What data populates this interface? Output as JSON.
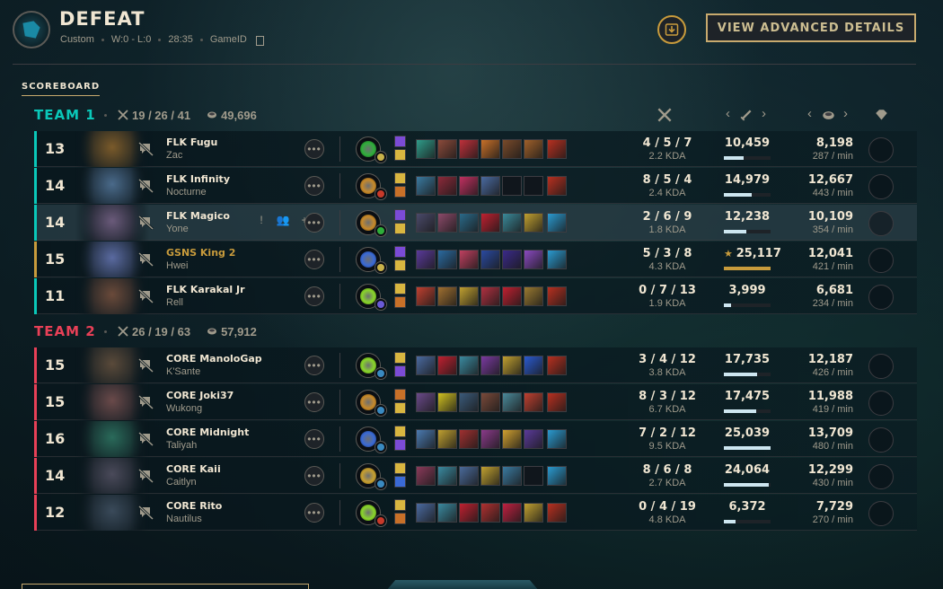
{
  "header": {
    "title": "DEFEAT",
    "mode": "Custom",
    "record": "W:0 - L:0",
    "duration": "28:35",
    "game_id_label": "GameID",
    "advanced_button": "VIEW ADVANCED DETAILS"
  },
  "scoreboard_label": "SCOREBOARD",
  "colors": {
    "gold_accent": "#c8aa6e",
    "team1": "#0ac8b9",
    "team2": "#e84057",
    "you": "#c89b3c",
    "text_light": "#f0e6d2",
    "text_muted": "#a09b8c"
  },
  "teams": [
    {
      "name": "TEAM 1",
      "kda": "19 / 26 / 41",
      "gold": "49,696",
      "players": [
        {
          "level": "13",
          "summoner": "FLK Fugu",
          "champion": "Zac",
          "kda": "4 / 5 / 7",
          "ratio": "2.2 KDA",
          "damage": "10,459",
          "damage_fraction": 0.42,
          "gold": "8,198",
          "gold_per_min": "287 / min",
          "portrait_color": "#7a5a2a",
          "keystone_color": "#2fae3a",
          "secondary_color": "#c8b24a",
          "spells": [
            "#7b4bd6",
            "#d8b640"
          ],
          "items": [
            "#2f9c8a",
            "#8c4a3a",
            "#c0303a",
            "#c87028",
            "#7a4a2a",
            "#a0602a",
            "#b83020"
          ],
          "you": false,
          "hovered": false
        },
        {
          "level": "14",
          "summoner": "FLK Infinity",
          "champion": "Nocturne",
          "kda": "8 / 5 / 4",
          "ratio": "2.4 KDA",
          "damage": "14,979",
          "damage_fraction": 0.6,
          "gold": "12,667",
          "gold_per_min": "443 / min",
          "portrait_color": "#4a6a8a",
          "keystone_color": "#c88a2a",
          "secondary_color": "#c83a2a",
          "spells": [
            "#d8b640",
            "#c87028"
          ],
          "items": [
            "#3a7aa0",
            "#8c2a3a",
            "#c03060",
            "#4a6aa0",
            "#10161c",
            "#10161c",
            "#b83020"
          ],
          "you": false,
          "hovered": false
        },
        {
          "level": "14",
          "summoner": "FLK Magico",
          "champion": "Yone",
          "kda": "2 / 6 / 9",
          "ratio": "1.8 KDA",
          "damage": "12,238",
          "damage_fraction": 0.49,
          "gold": "10,109",
          "gold_per_min": "354 / min",
          "portrait_color": "#6a5a7a",
          "keystone_color": "#c88a2a",
          "secondary_color": "#2fae3a",
          "spells": [
            "#7b4bd6",
            "#d8b640"
          ],
          "items": [
            "#4a4a6a",
            "#8c4a6a",
            "#2a6a8a",
            "#c02030",
            "#3a8a9a",
            "#c0a030",
            "#2a9ad0"
          ],
          "you": false,
          "hovered": true
        },
        {
          "level": "15",
          "summoner": "GSNS King 2",
          "champion": "Hwei",
          "kda": "5 / 3 / 8",
          "ratio": "4.3 KDA",
          "damage": "25,117",
          "damage_fraction": 1.0,
          "gold": "12,041",
          "gold_per_min": "421 / min",
          "portrait_color": "#5a6aa0",
          "keystone_color": "#3a6ad6",
          "secondary_color": "#c8b24a",
          "spells": [
            "#7b4bd6",
            "#d8b640"
          ],
          "items": [
            "#5a3a9a",
            "#2a6aa0",
            "#c04060",
            "#2a4aa0",
            "#3a2a8a",
            "#8a4ac0",
            "#2a9ad0"
          ],
          "you": true,
          "hovered": false
        },
        {
          "level": "11",
          "summoner": "FLK Karakal Jr",
          "champion": "Rell",
          "kda": "0 / 7 / 13",
          "ratio": "1.9 KDA",
          "damage": "3,999",
          "damage_fraction": 0.16,
          "gold": "6,681",
          "gold_per_min": "234 / min",
          "portrait_color": "#6a4a3a",
          "keystone_color": "#8ad62a",
          "secondary_color": "#6a5ad6",
          "spells": [
            "#d8b640",
            "#c87028"
          ],
          "items": [
            "#c04030",
            "#a07030",
            "#c0a030",
            "#b03040",
            "#c02030",
            "#9a7a30",
            "#b83020"
          ],
          "you": false,
          "hovered": false
        }
      ]
    },
    {
      "name": "TEAM 2",
      "kda": "26 / 19 / 63",
      "gold": "57,912",
      "players": [
        {
          "level": "15",
          "summoner": "CORE ManoloGap",
          "champion": "K'Sante",
          "kda": "3 / 4 / 12",
          "ratio": "3.8 KDA",
          "damage": "17,735",
          "damage_fraction": 0.71,
          "gold": "12,187",
          "gold_per_min": "426 / min",
          "portrait_color": "#5a4a3a",
          "keystone_color": "#8ad62a",
          "secondary_color": "#3a8ac0",
          "spells": [
            "#d8b640",
            "#7b4bd6"
          ],
          "items": [
            "#4a6aa0",
            "#c02030",
            "#3a8aa0",
            "#7a3aa0",
            "#c0a030",
            "#2a5ad0",
            "#b83020"
          ],
          "you": false,
          "hovered": false
        },
        {
          "level": "15",
          "summoner": "CORE Joki37",
          "champion": "Wukong",
          "kda": "8 / 3 / 12",
          "ratio": "6.7 KDA",
          "damage": "17,475",
          "damage_fraction": 0.7,
          "gold": "11,988",
          "gold_per_min": "419 / min",
          "portrait_color": "#6a4a4a",
          "keystone_color": "#c88a2a",
          "secondary_color": "#3a8ac0",
          "spells": [
            "#c87028",
            "#d8b640"
          ],
          "items": [
            "#6a4a8a",
            "#d0c020",
            "#3a5a7a",
            "#7a4a3a",
            "#4a8a9a",
            "#c04030",
            "#b83020"
          ],
          "you": false,
          "hovered": false
        },
        {
          "level": "16",
          "summoner": "CORE Midnight",
          "champion": "Taliyah",
          "kda": "7 / 2 / 12",
          "ratio": "9.5 KDA",
          "damage": "25,039",
          "damage_fraction": 1.0,
          "gold": "13,709",
          "gold_per_min": "480 / min",
          "portrait_color": "#2a6a5a",
          "keystone_color": "#3a6ad6",
          "secondary_color": "#3a8ac0",
          "spells": [
            "#d8b640",
            "#7b4bd6"
          ],
          "items": [
            "#4a7ab0",
            "#c0a030",
            "#a03030",
            "#8a3a8a",
            "#d0a030",
            "#5a3a9a",
            "#2a9ad0"
          ],
          "you": false,
          "hovered": false
        },
        {
          "level": "14",
          "summoner": "CORE Kaii",
          "champion": "Caitlyn",
          "kda": "8 / 6 / 8",
          "ratio": "2.7 KDA",
          "damage": "24,064",
          "damage_fraction": 0.96,
          "gold": "12,299",
          "gold_per_min": "430 / min",
          "portrait_color": "#4a4a5a",
          "keystone_color": "#c8a030",
          "secondary_color": "#3a8ac0",
          "spells": [
            "#d8b640",
            "#3a6ad6"
          ],
          "items": [
            "#8a3a5a",
            "#3a8aa0",
            "#4a6a9a",
            "#c0a030",
            "#3a7aa0",
            "#10161c",
            "#2a9ad0"
          ],
          "you": false,
          "hovered": false
        },
        {
          "level": "12",
          "summoner": "CORE Rito",
          "champion": "Nautilus",
          "kda": "0 / 4 / 19",
          "ratio": "4.8 KDA",
          "damage": "6,372",
          "damage_fraction": 0.25,
          "gold": "7,729",
          "gold_per_min": "270 / min",
          "portrait_color": "#3a4a5a",
          "keystone_color": "#8ad62a",
          "secondary_color": "#c83a2a",
          "spells": [
            "#d8b640",
            "#c87028"
          ],
          "items": [
            "#4a6aa0",
            "#3a8aa0",
            "#c02030",
            "#b03030",
            "#c02040",
            "#c0a030",
            "#b83020"
          ],
          "you": false,
          "hovered": false
        }
      ]
    }
  ],
  "hover_actions": [
    "!",
    "👥",
    "+"
  ],
  "more_glyph": "•••"
}
